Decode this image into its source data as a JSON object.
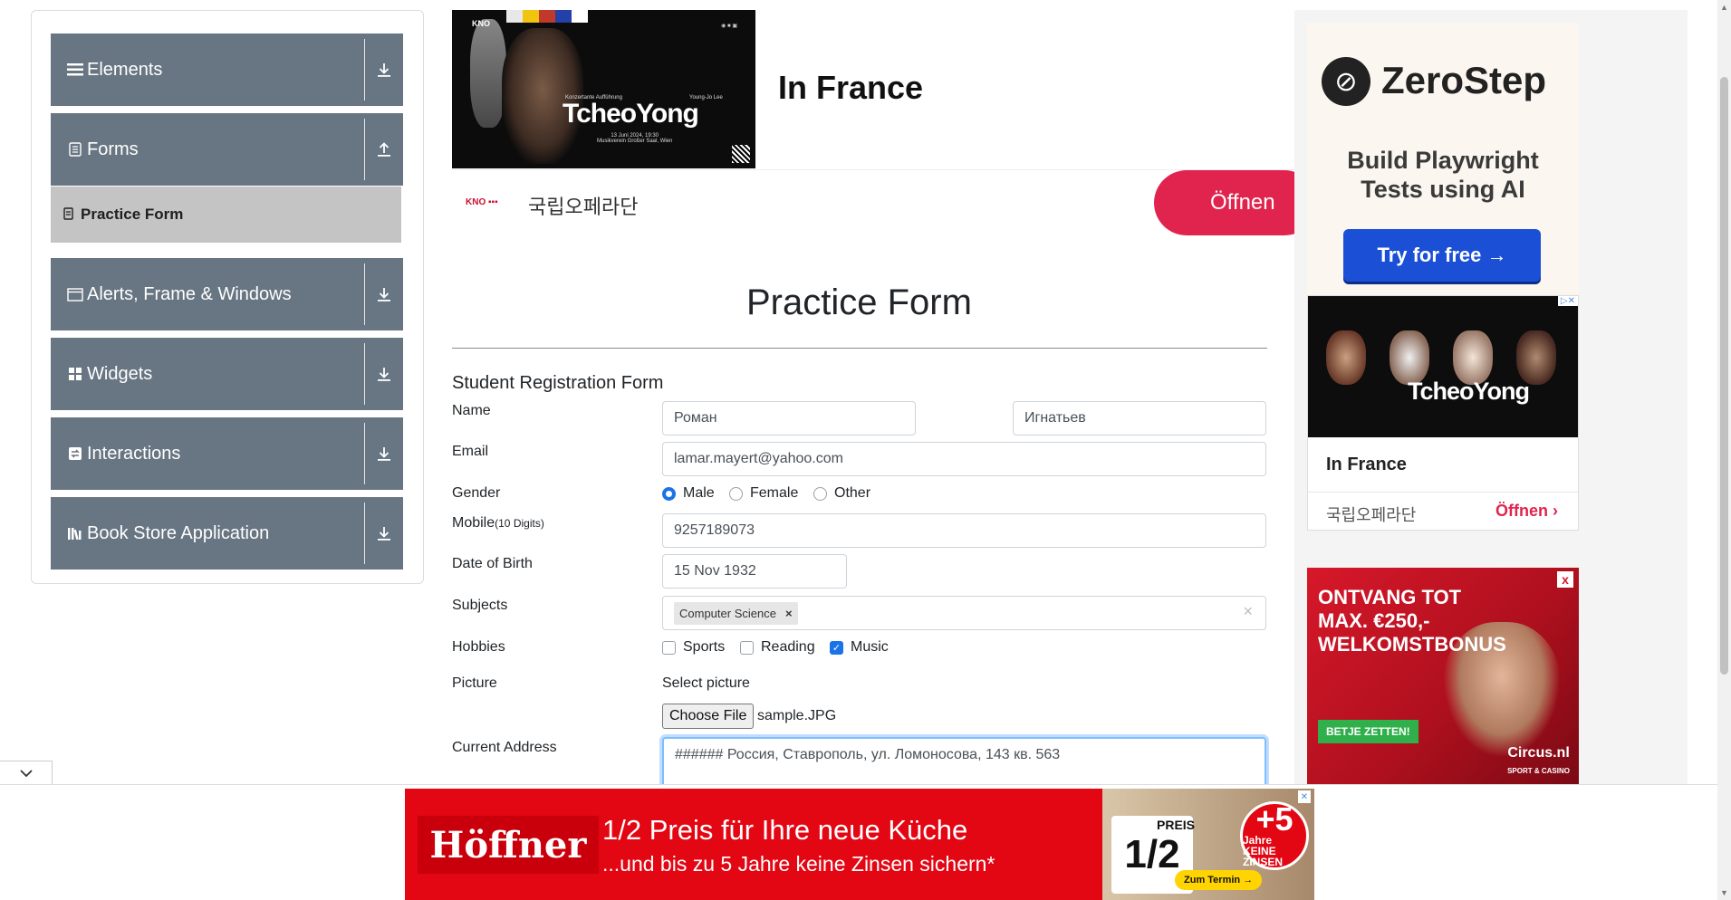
{
  "sidebar": {
    "groups": [
      {
        "label": "Elements",
        "icon": "hamburger-icon",
        "arrow": "download-icon"
      },
      {
        "label": "Forms",
        "icon": "document-icon",
        "arrow": "upload-icon"
      },
      {
        "label": "Alerts, Frame & Windows",
        "icon": "window-icon",
        "arrow": "download-icon"
      },
      {
        "label": "Widgets",
        "icon": "widgets-icon",
        "arrow": "download-icon"
      },
      {
        "label": "Interactions",
        "icon": "interactions-icon",
        "arrow": "download-icon"
      },
      {
        "label": "Book Store Application",
        "icon": "books-icon",
        "arrow": "download-icon"
      }
    ],
    "active_item": {
      "label": "Practice Form",
      "icon": "form-icon"
    }
  },
  "top_ad": {
    "poster_title": "TcheoYong",
    "poster_caption": "Konzertante Aufführung",
    "poster_composer": "Young-Jo Lee",
    "poster_date": "13 Juni 2024, 19:30",
    "poster_venue": "Musikverein Großer Saal, Wien",
    "title": "In France",
    "brand": "국립오페라단",
    "open_label": "Öffnen"
  },
  "right_ads": {
    "zerostep": {
      "name": "ZeroStep",
      "tagline": "Build Playwright Tests using AI",
      "button": "Try for free →"
    },
    "kno": {
      "poster_title": "TcheoYong",
      "title": "In France",
      "brand": "국립오페라단",
      "open_label": "Öffnen"
    },
    "circus": {
      "headline": "ONTVANG TOT MAX. €250,- WELKOMSTBONUS",
      "button": "BETJE ZETTEN!",
      "brand": "Circus.nl",
      "brand_sub": "SPORT & CASINO",
      "close": "x"
    }
  },
  "form": {
    "page_title": "Practice Form",
    "subtitle": "Student Registration Form",
    "labels": {
      "name": "Name",
      "email": "Email",
      "gender": "Gender",
      "mobile": "Mobile",
      "mobile_hint": "(10 Digits)",
      "dob": "Date of Birth",
      "subjects": "Subjects",
      "hobbies": "Hobbies",
      "picture": "Picture",
      "address": "Current Address"
    },
    "first_name": "Роман",
    "last_name": "Игнатьев",
    "email": "lamar.mayert@yahoo.com",
    "gender_options": [
      "Male",
      "Female",
      "Other"
    ],
    "gender_selected": "Male",
    "mobile": "9257189073",
    "dob": "15 Nov 1932",
    "subjects": [
      "Computer Science"
    ],
    "hobbies": [
      {
        "label": "Sports",
        "checked": false
      },
      {
        "label": "Reading",
        "checked": false
      },
      {
        "label": "Music",
        "checked": true
      }
    ],
    "picture_prompt": "Select picture",
    "choose_file": "Choose File",
    "file_name": "sample.JPG",
    "address": "###### Россия, Ставрополь, ул. Ломоносова, 143 кв. 563"
  },
  "bottom_ad": {
    "brand": "Höffner",
    "line1": "1/2 Preis für Ihre neue Küche",
    "line2": "...und bis zu 5 Jahre keine Zinsen sichern*",
    "half": "1/2",
    "preis": "PREIS",
    "badge_number": "+5",
    "badge_text": "Jahre KEINE ZINSEN",
    "cta": "Zum Termin →"
  },
  "colors": {
    "sidebar_group": "#687582",
    "active_item": "#c4c4c4",
    "open_button": "#e0244d",
    "hoeffner_red": "#e30613",
    "radio_checked": "#1a73e8"
  }
}
